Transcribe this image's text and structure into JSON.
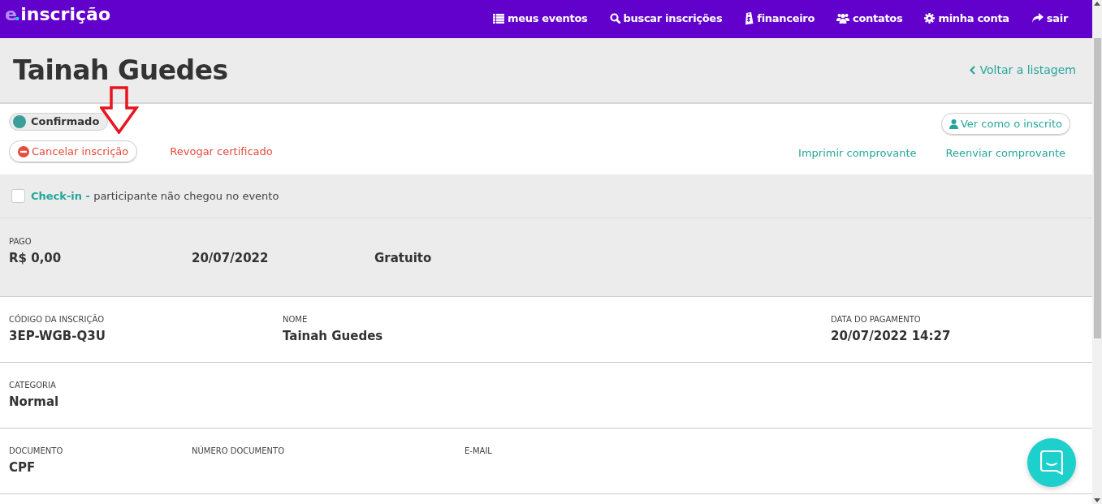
{
  "header": {
    "logo": {
      "prefix": "e",
      "dot": ".",
      "text": "inscrição"
    },
    "nav": [
      {
        "label": "meus eventos"
      },
      {
        "label": "buscar inscrições"
      },
      {
        "label": "financeiro"
      },
      {
        "label": "contatos"
      },
      {
        "label": "minha conta"
      },
      {
        "label": "sair"
      }
    ]
  },
  "title": "Tainah Guedes",
  "back_link": "Voltar a listagem",
  "status": {
    "label": "Confirmado",
    "color": "#3a9e99"
  },
  "actions_left": [
    {
      "kind": "button",
      "label": "Cancelar inscrição"
    },
    {
      "kind": "link",
      "label": "Revogar certificado"
    }
  ],
  "view_as_button": "Ver como o inscrito",
  "actions_right": [
    "Imprimir comprovante",
    "Reenviar comprovante"
  ],
  "checkin": {
    "checked": false,
    "label": "Check-in -",
    "text": "participante não chegou no evento"
  },
  "payment": [
    {
      "label": "PAGO",
      "value": "R$ 0,00"
    },
    {
      "value": "20/07/2022"
    },
    {
      "value": "Gratuito"
    }
  ],
  "rows": [
    [
      {
        "label": "CÓDIGO DA INSCRIÇÃO",
        "value": "3EP-WGB-Q3U"
      },
      {
        "label": "NOME",
        "value": "Tainah Guedes"
      },
      {
        "label": "DATA DO PAGAMENTO",
        "value": "20/07/2022 14:27"
      }
    ],
    [
      {
        "label": "CATEGORIA",
        "value": "Normal"
      }
    ],
    [
      {
        "label": "DOCUMENTO",
        "value": "CPF"
      },
      {
        "label": "NÚMERO DOCUMENTO"
      },
      {
        "label": "E-MAIL"
      }
    ]
  ]
}
